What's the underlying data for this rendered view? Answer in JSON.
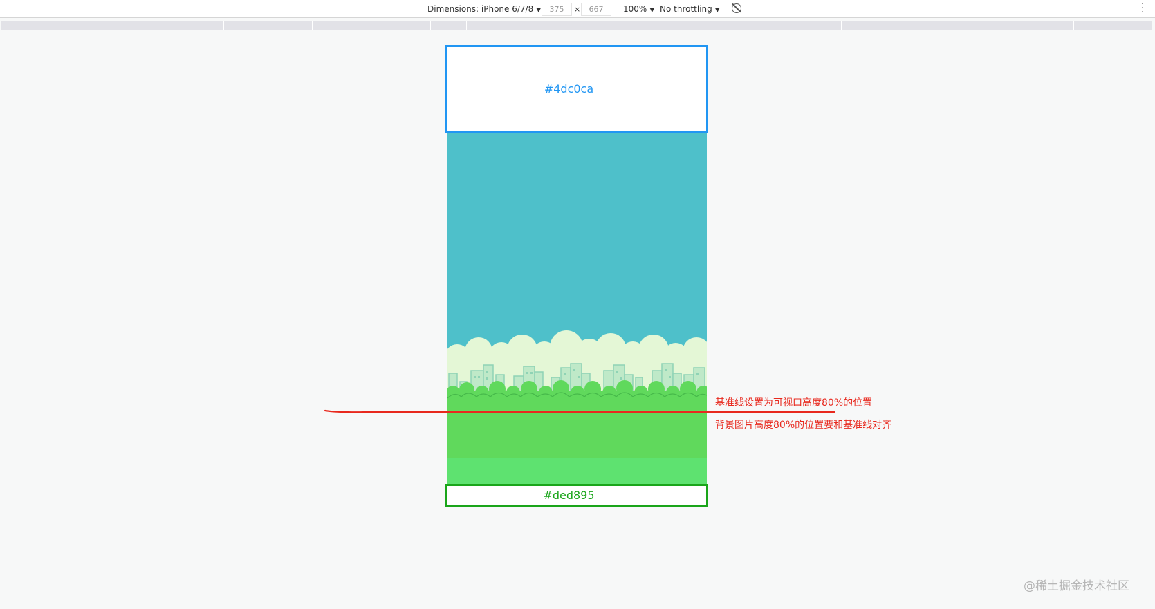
{
  "toolbar": {
    "device_label": "Dimensions: iPhone 6/7/8",
    "width_value": "375",
    "times": "×",
    "height_value": "667",
    "zoom": "100%",
    "throttling": "No throttling"
  },
  "viewport": {
    "sky_color": "#4ec0ca",
    "ground_color": "#5ee270"
  },
  "boxes": {
    "top_label": "#4dc0ca",
    "bottom_label": "#ded895",
    "top_border_color": "#2196f3",
    "bottom_border_color": "#1aa51a"
  },
  "annotations": {
    "line1": "基准线设置为可视口高度80%的位置",
    "line2": "背景图片高度80%的位置要和基准线对齐",
    "color": "#e8291e"
  },
  "watermark": "@稀土掘金技术社区"
}
